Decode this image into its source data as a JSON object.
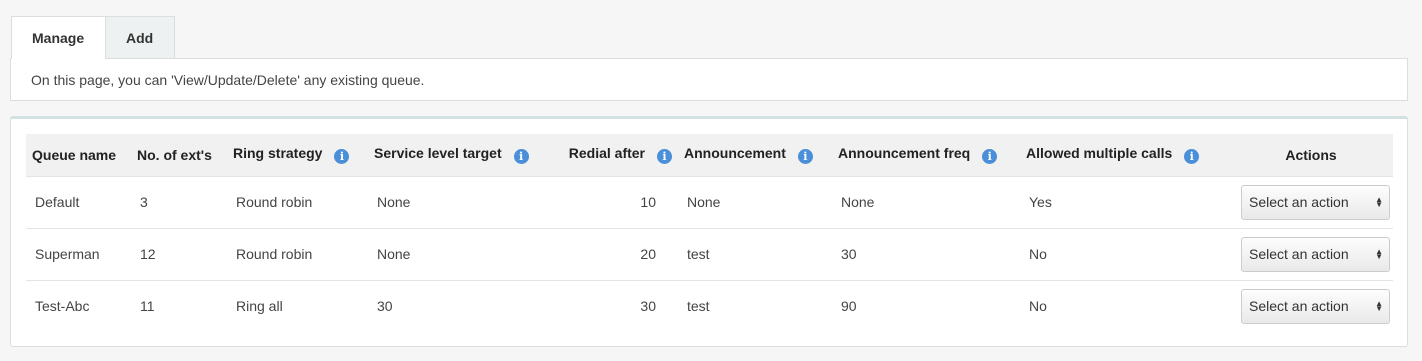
{
  "tabs": [
    {
      "label": "Manage",
      "active": true
    },
    {
      "label": "Add",
      "active": false
    }
  ],
  "intro_text": "On this page, you can 'View/Update/Delete' any existing queue.",
  "table": {
    "headers": {
      "queue_name": "Queue name",
      "num_exts": "No. of ext's",
      "ring_strategy": "Ring strategy",
      "service_level": "Service level target",
      "redial_after": "Redial after",
      "announcement": "Announcement",
      "announcement_freq": "Announcement freq",
      "allowed_multiple": "Allowed multiple calls",
      "actions": "Actions"
    },
    "rows": [
      {
        "queue_name": "Default",
        "num_exts": "3",
        "ring_strategy": "Round robin",
        "service_level": "None",
        "redial_after": "10",
        "announcement": "None",
        "announcement_freq": "None",
        "allowed_multiple": "Yes",
        "action": "Select an action"
      },
      {
        "queue_name": "Superman",
        "num_exts": "12",
        "ring_strategy": "Round robin",
        "service_level": "None",
        "redial_after": "20",
        "announcement": "test",
        "announcement_freq": "30",
        "allowed_multiple": "No",
        "action": "Select an action"
      },
      {
        "queue_name": "Test-Abc",
        "num_exts": "11",
        "ring_strategy": "Ring all",
        "service_level": "30",
        "redial_after": "30",
        "announcement": "test",
        "announcement_freq": "90",
        "allowed_multiple": "No",
        "action": "Select an action"
      }
    ]
  },
  "colors": {
    "info_icon": "#4a8fd8",
    "tab_inactive_bg": "#eef1f1",
    "header_bg": "#f1f1f1"
  }
}
